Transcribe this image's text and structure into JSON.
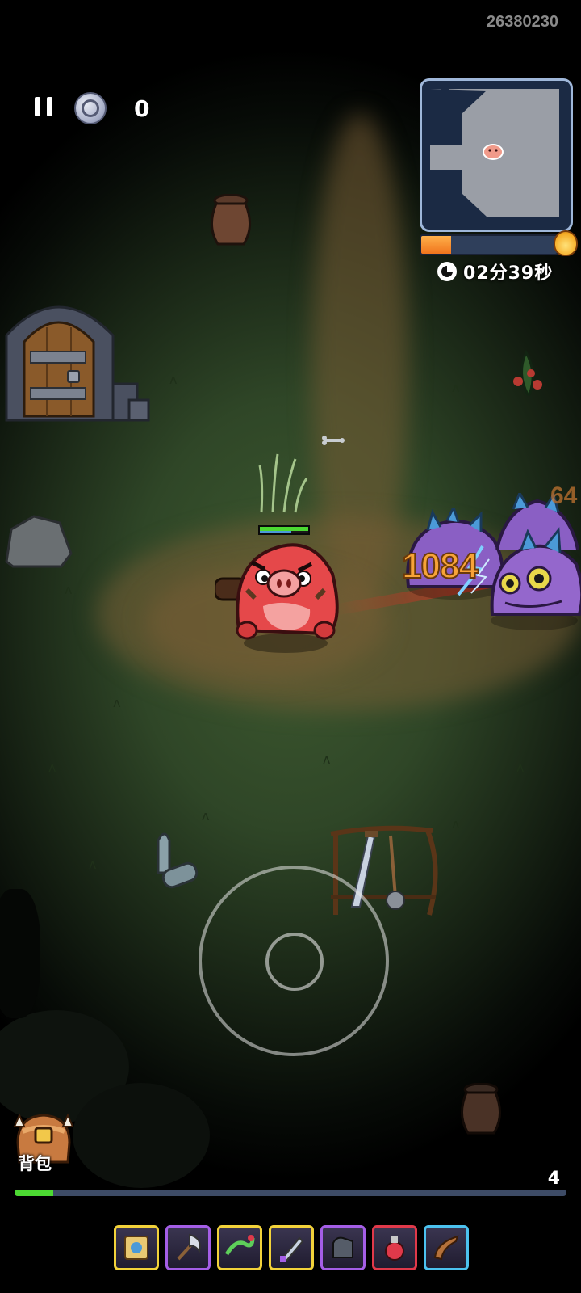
{
  "hud": {
    "player_id": "26380230",
    "coin_count": "0",
    "timer": "02分39秒",
    "xp_progress": 0.22
  },
  "combat": {
    "damage_main": "1084",
    "damage_offscreen": "64"
  },
  "player": {
    "health_fraction": 1.0,
    "shield_fraction": 0.65
  },
  "bag": {
    "label": "背包"
  },
  "level": {
    "value": "4",
    "progress": 0.07
  },
  "skills": [
    {
      "name": "scroll-icon",
      "border": "#f2d23a"
    },
    {
      "name": "battle-axe-icon",
      "border": "#a45ee6"
    },
    {
      "name": "dragon-icon",
      "border": "#f2d23a"
    },
    {
      "name": "dagger-icon",
      "border": "#f2d23a"
    },
    {
      "name": "gauntlet-icon",
      "border": "#a45ee6"
    },
    {
      "name": "potion-icon",
      "border": "#e0394a"
    },
    {
      "name": "horn-icon",
      "border": "#4cc2ef"
    }
  ],
  "colors": {
    "damage": "#f7a338",
    "health": "#4cd932",
    "xp": "#f0741d"
  }
}
